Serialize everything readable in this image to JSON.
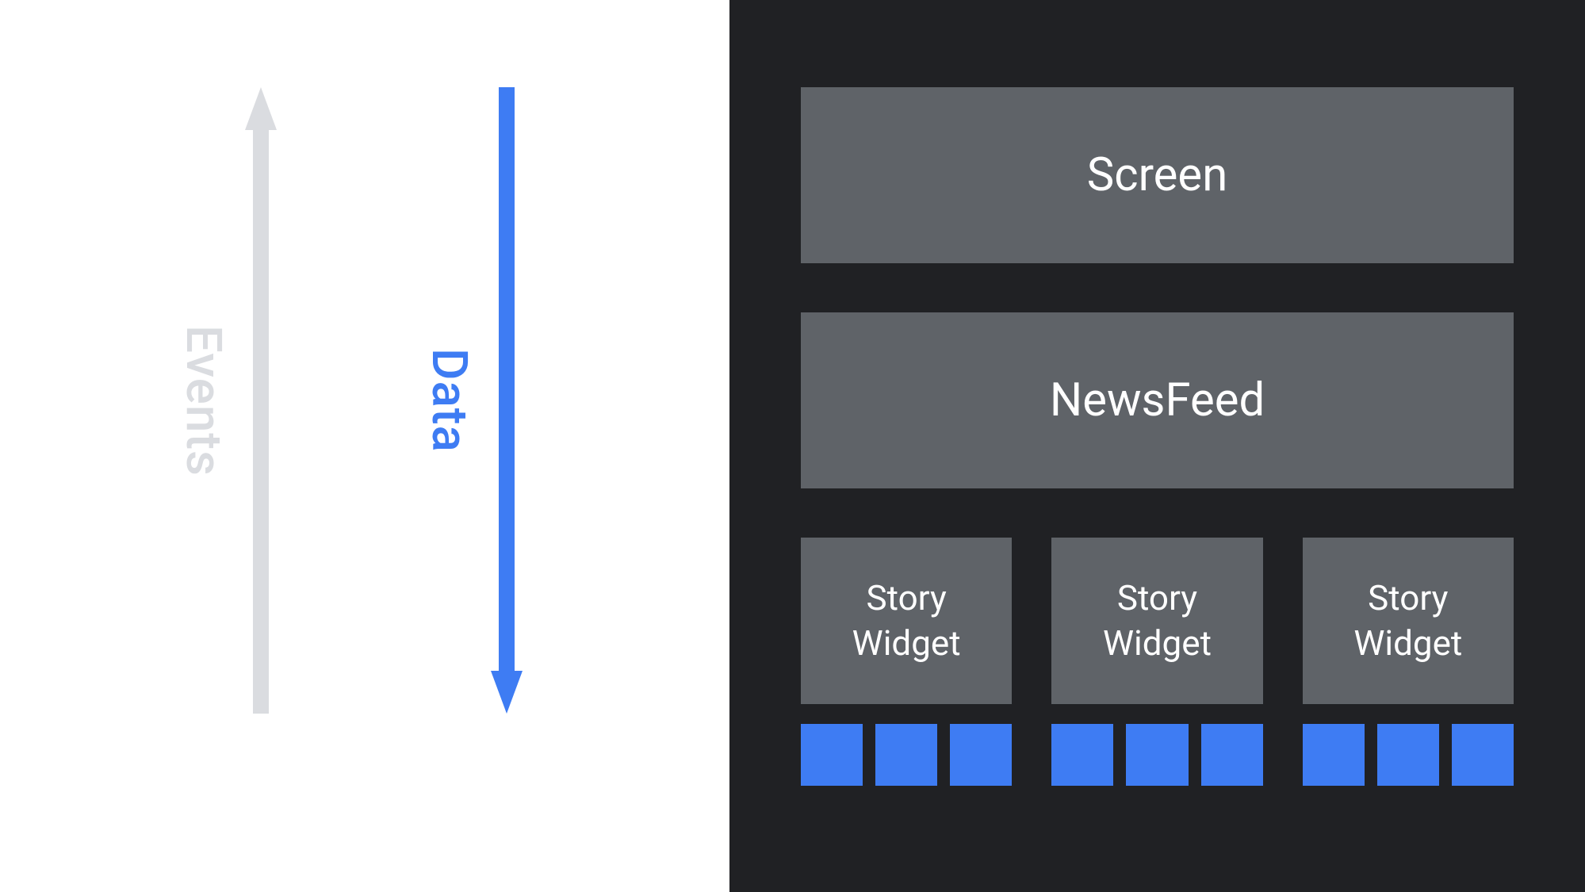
{
  "left": {
    "events_label": "Events",
    "data_label": "Data"
  },
  "right": {
    "screen_label": "Screen",
    "newsfeed_label": "NewsFeed",
    "widgets": [
      "Story Widget",
      "Story Widget",
      "Story Widget"
    ],
    "chips_per_group": 3
  },
  "colors": {
    "events_arrow": "#dadce0",
    "data_arrow": "#3e7cf3",
    "right_bg": "#202124",
    "box_bg": "#5f6368",
    "chip_bg": "#3e7cf3"
  }
}
